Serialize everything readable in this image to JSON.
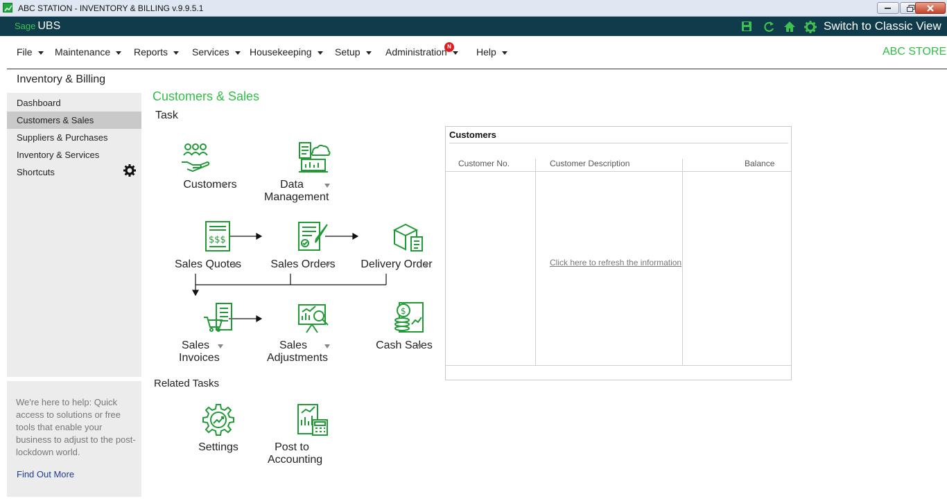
{
  "window": {
    "title": "ABC STATION - INVENTORY & BILLING v.9.9.5.1"
  },
  "brand": {
    "sage": "Sage",
    "product": "UBS",
    "switch_label": "Switch to Classic View"
  },
  "menu": {
    "items": [
      "File",
      "Maintenance",
      "Reports",
      "Services",
      "Housekeeping",
      "Setup",
      "Administration",
      "Help"
    ],
    "badge": "N",
    "store": "ABC STORE"
  },
  "sidebar": {
    "section_title": "Inventory & Billing",
    "items": [
      "Dashboard",
      "Customers & Sales",
      "Suppliers & Purchases",
      "Inventory & Services",
      "Shortcuts"
    ],
    "active_index": 1
  },
  "help": {
    "text": "We're here to help: Quick access to solutions or free tools that enable your business to adjust to the post-lockdown world.",
    "link": "Find Out More"
  },
  "main": {
    "title": "Customers & Sales",
    "task_label": "Task",
    "related_label": "Related Tasks",
    "tasks": {
      "customers": "Customers",
      "data_management": [
        "Data",
        "Management"
      ],
      "sales_quotes": "Sales Quotes",
      "sales_orders": "Sales Orders",
      "delivery_order": "Delivery Order",
      "sales_invoices": [
        "Sales",
        "Invoices"
      ],
      "sales_adjustments": [
        "Sales",
        "Adjustments"
      ],
      "cash_sales": "Cash Sales"
    },
    "related": {
      "settings": "Settings",
      "post_to_accounting": [
        "Post to",
        "Accounting"
      ]
    }
  },
  "customers_panel": {
    "title": "Customers",
    "columns": [
      "Customer No.",
      "Customer Description",
      "Balance"
    ],
    "refresh": "Click here to refresh the information"
  },
  "colors": {
    "accent": "#2fbf45",
    "brandbar": "#0f3b4a",
    "icon_green": "#1f9a35"
  }
}
